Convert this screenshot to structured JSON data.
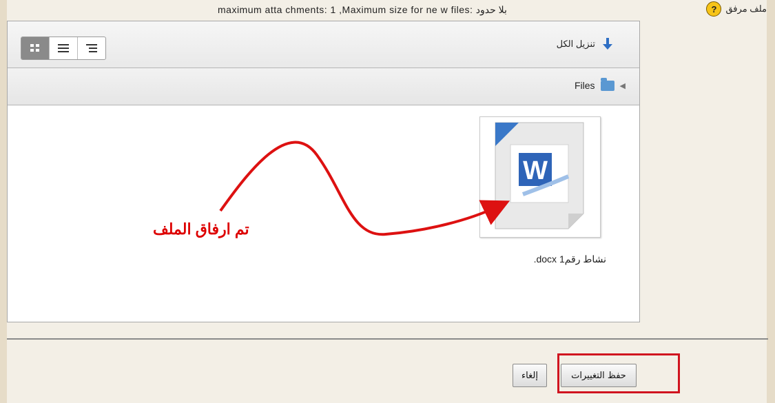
{
  "header": {
    "field_label": "ملف مرفق",
    "help_icon": "question-icon",
    "restrictions": "maximum atta chments: 1 ,Maximum size for ne w files: بلا حدود"
  },
  "filemanager": {
    "toolbar": {
      "download_all_label": "تنزيل الكل",
      "download_icon": "down-arrow-icon",
      "view_modes": [
        {
          "icon": "grid-icon",
          "glyph": "▦",
          "active": true
        },
        {
          "icon": "list-icon",
          "glyph": "≡",
          "active": false
        },
        {
          "icon": "tree-icon",
          "glyph": "☰",
          "active": false
        }
      ]
    },
    "path": {
      "root_label": "Files",
      "folder_icon": "folder-icon",
      "triangle_icon": "triangle-left-icon"
    },
    "files": [
      {
        "name": ".docx نشاط رقم1",
        "icon": "word-document-icon"
      }
    ]
  },
  "annotation": {
    "text": "تم ارفاق الملف",
    "color": "#dd1111"
  },
  "actions": {
    "save_label": "حفظ التغييرات",
    "cancel_label": "إلغاء",
    "highlight_color": "#d0141f"
  }
}
